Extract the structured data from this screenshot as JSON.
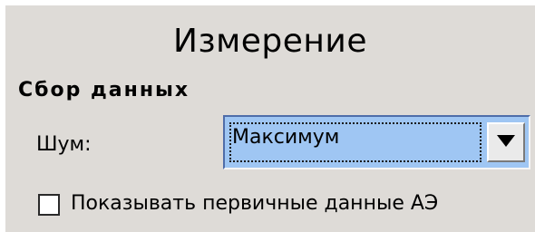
{
  "panel": {
    "title": "Измерение",
    "section": "Сбор данных"
  },
  "noise": {
    "label": "Шум:",
    "selected": "Максимум",
    "dropdown_icon": "triangle-down-icon"
  },
  "checkbox": {
    "label": "Показывать первичные данные АЭ",
    "checked": false
  },
  "colors": {
    "panel_bg": "#dedbd7",
    "combo_bg": "#9fc6f3",
    "combo_border": "#4f6da9"
  }
}
